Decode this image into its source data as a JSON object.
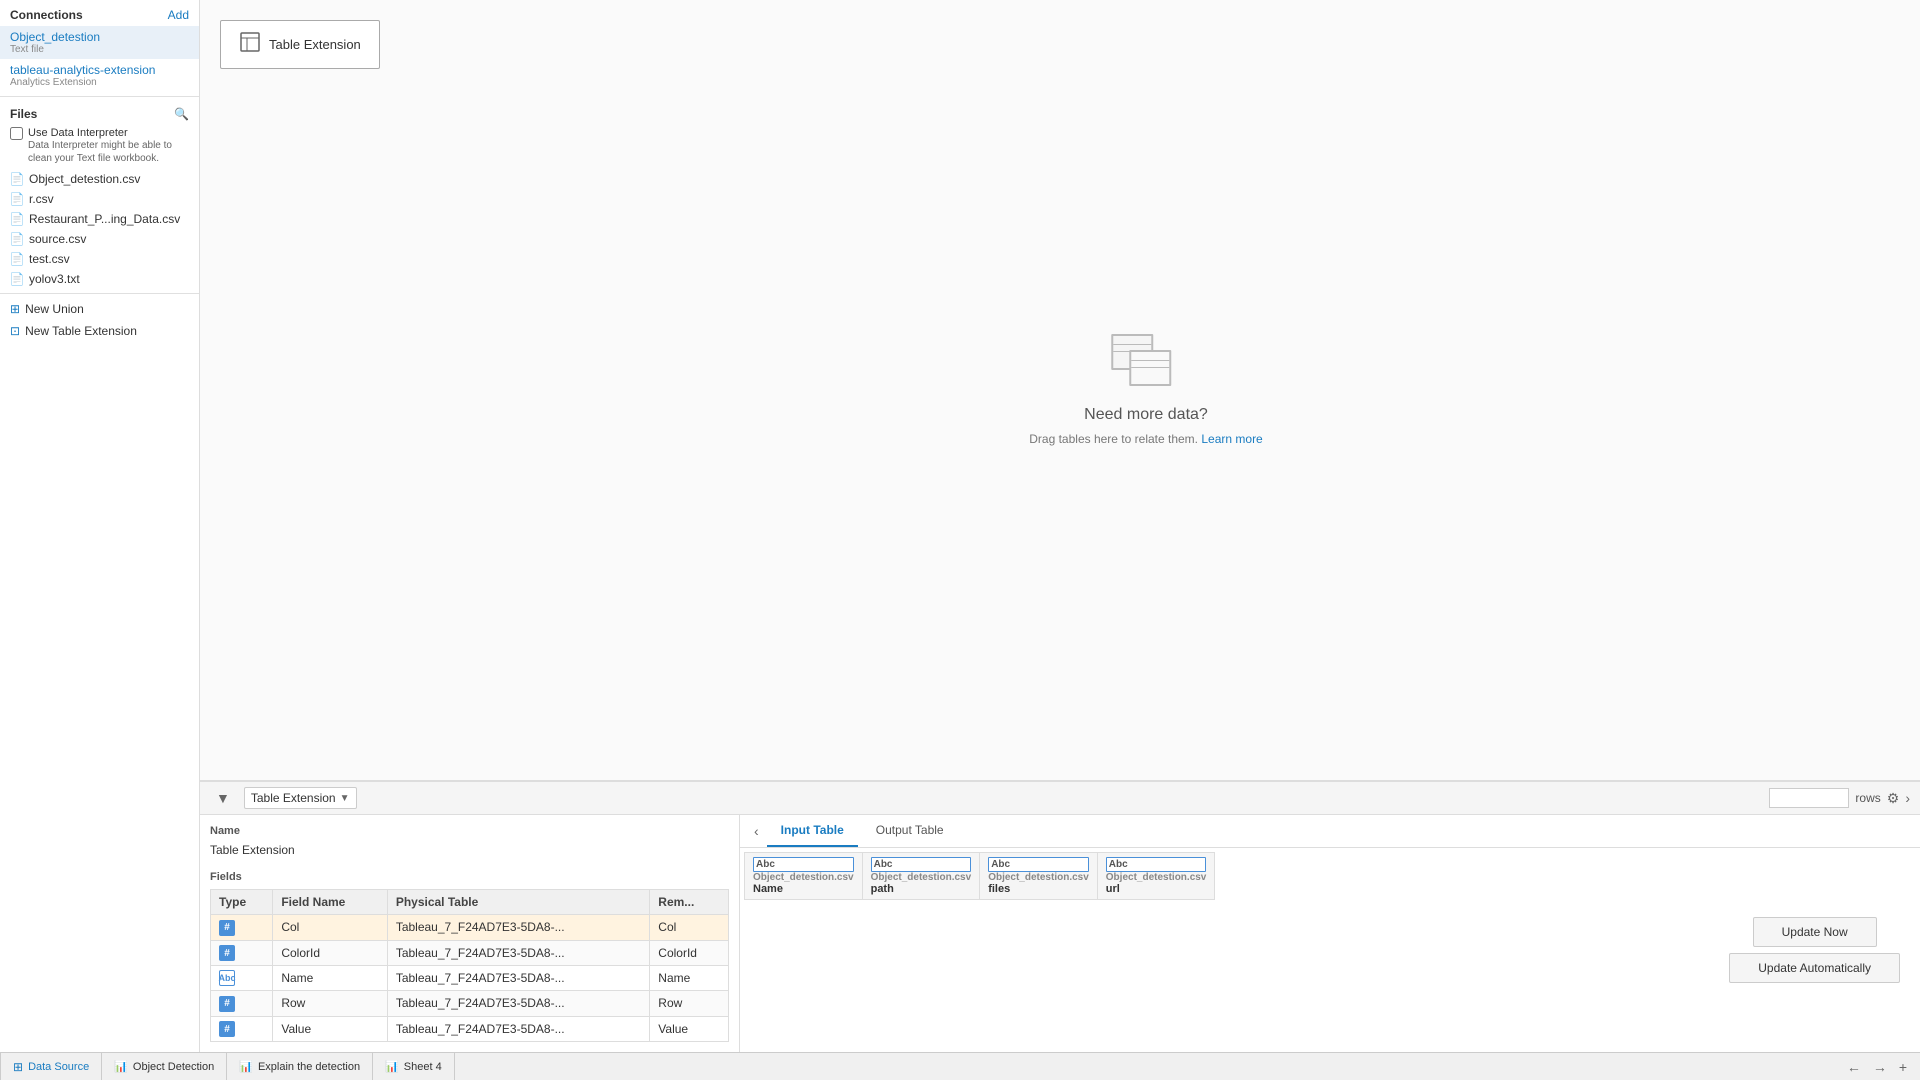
{
  "connections": {
    "header": "Connections",
    "add_label": "Add",
    "items": [
      {
        "name": "Object_detestion",
        "type": "Text file",
        "active": true
      },
      {
        "name": "tableau-analytics-extension",
        "type": "Analytics Extension",
        "active": false
      }
    ]
  },
  "files": {
    "header": "Files",
    "use_data_interpreter": {
      "label": "Use Data Interpreter",
      "sublabel": "Data Interpreter might be able to clean your Text file workbook."
    },
    "items": [
      "Object_detestion.csv",
      "r.csv",
      "Restaurant_P...ing_Data.csv",
      "source.csv",
      "test.csv",
      "yolov3.txt"
    ],
    "new_items": [
      "New Union",
      "New Table Extension"
    ]
  },
  "canvas": {
    "table_extension_label": "Table Extension",
    "need_more_data": {
      "title": "Need more data?",
      "subtitle": "Drag tables here to relate them.",
      "learn_more": "Learn more"
    }
  },
  "bottom_toolbar": {
    "dropdown_label": "Table Extension",
    "rows_label": "rows"
  },
  "tabs": {
    "items": [
      "Input Table",
      "Output Table"
    ],
    "active": "Input Table"
  },
  "fields": {
    "name_label": "Name",
    "name_value": "Table Extension",
    "fields_label": "Fields",
    "columns": [
      "Type",
      "Field Name",
      "Physical Table",
      "Rem..."
    ],
    "rows": [
      {
        "type": "num",
        "field_name": "Col",
        "physical_table": "Tableau_7_F24AD7E3-5DA8-...",
        "remap": "Col",
        "highlight": true
      },
      {
        "type": "num",
        "field_name": "ColorId",
        "physical_table": "Tableau_7_F24AD7E3-5DA8-...",
        "remap": "ColorId",
        "highlight": false
      },
      {
        "type": "abc",
        "field_name": "Name",
        "physical_table": "Tableau_7_F24AD7E3-5DA8-...",
        "remap": "Name",
        "highlight": false
      },
      {
        "type": "num",
        "field_name": "Row",
        "physical_table": "Tableau_7_F24AD7E3-5DA8-...",
        "remap": "Row",
        "highlight": false
      },
      {
        "type": "num",
        "field_name": "Value",
        "physical_table": "Tableau_7_F24AD7E3-5DA8-...",
        "remap": "Value",
        "highlight": false
      }
    ]
  },
  "data_columns": [
    {
      "type": "Abc",
      "source": "Object_detestion.csv",
      "name": "Name"
    },
    {
      "type": "Abc",
      "source": "Object_detestion.csv",
      "name": "path"
    },
    {
      "type": "Abc",
      "source": "Object_detestion.csv",
      "name": "files"
    },
    {
      "type": "Abc",
      "source": "Object_detestion.csv",
      "name": "url"
    }
  ],
  "action_buttons": {
    "update_now": "Update Now",
    "update_automatically": "Update Automatically"
  },
  "status_bar": {
    "data_source": "Data Source",
    "sheets": [
      "Object Detection",
      "Explain the detection",
      "Sheet 4"
    ]
  }
}
